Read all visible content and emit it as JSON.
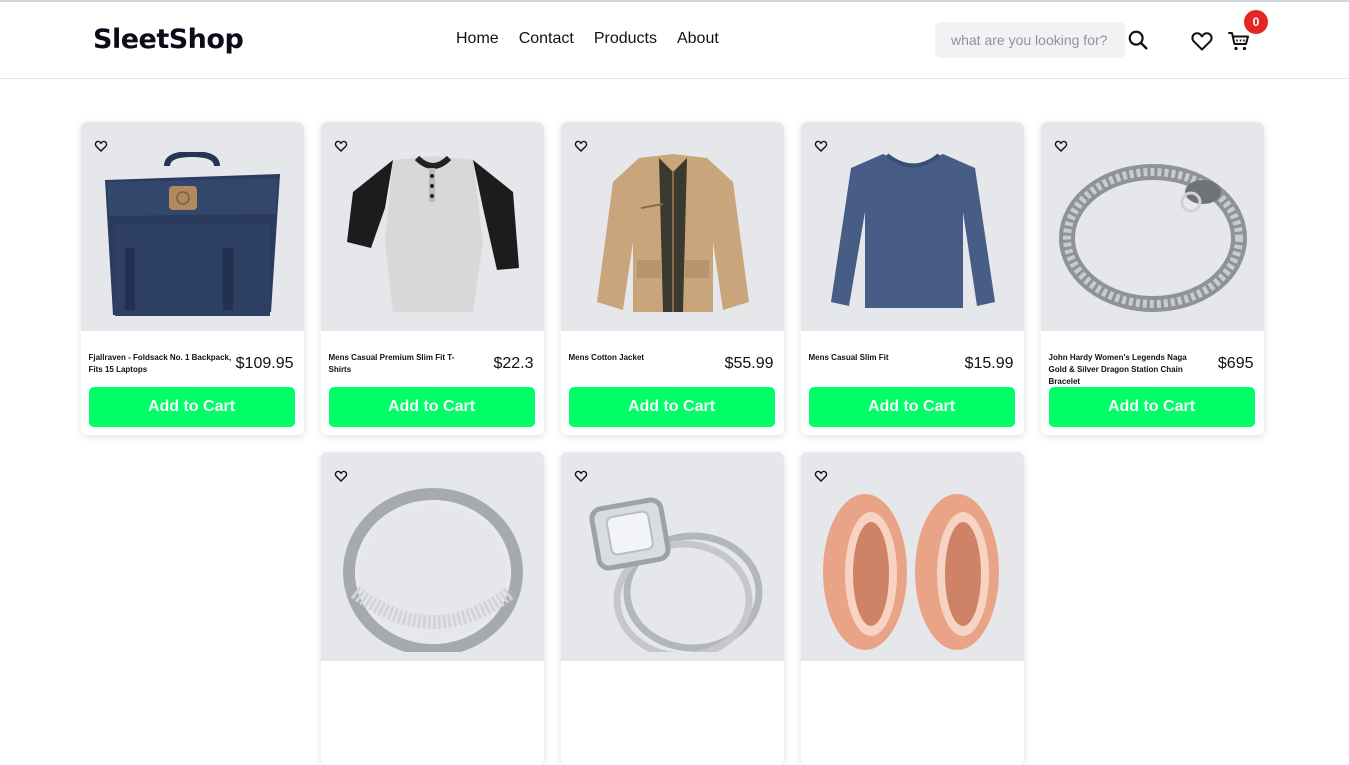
{
  "brand": {
    "name": "SleetShop"
  },
  "nav": {
    "items": [
      "Home",
      "Contact",
      "Products",
      "About"
    ]
  },
  "search": {
    "placeholder": "what are you looking for?",
    "value": ""
  },
  "icons": {
    "search": "search-icon",
    "wishlist": "heart-icon",
    "cart": "cart-icon",
    "favorite": "heart-outline-icon"
  },
  "cart": {
    "count": "0"
  },
  "colors": {
    "accent": "#00ff66",
    "badge": "#e32626",
    "card_image_bg": "#e5e7eb"
  },
  "products": [
    {
      "title": "Fjallraven - Foldsack No. 1 Backpack, Fits 15 Laptops",
      "price": "$109.95",
      "button": "Add to Cart",
      "image": "backpack"
    },
    {
      "title": "Mens Casual Premium Slim Fit T-Shirts",
      "price": "$22.3",
      "button": "Add to Cart",
      "image": "tshirt"
    },
    {
      "title": "Mens Cotton Jacket",
      "price": "$55.99",
      "button": "Add to Cart",
      "image": "jacket"
    },
    {
      "title": "Mens Casual Slim Fit",
      "price": "$15.99",
      "button": "Add to Cart",
      "image": "longsleeve"
    },
    {
      "title": "John Hardy Women's Legends Naga Gold & Silver Dragon Station Chain Bracelet",
      "price": "$695",
      "button": "Add to Cart",
      "image": "bracelet"
    },
    {
      "title": "",
      "price": "",
      "button": "",
      "image": "silver-ring"
    },
    {
      "title": "",
      "price": "",
      "button": "",
      "image": "diamond-ring"
    },
    {
      "title": "",
      "price": "",
      "button": "",
      "image": "rose-gold-plugs"
    }
  ]
}
